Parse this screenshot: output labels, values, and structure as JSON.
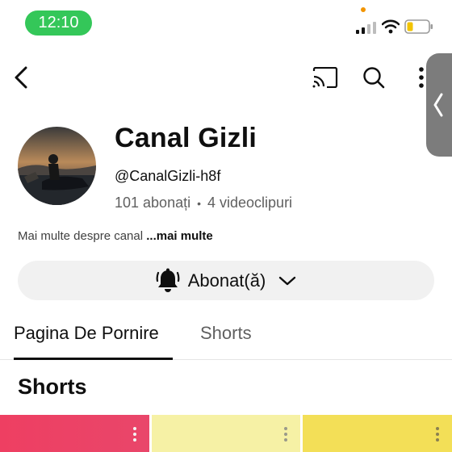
{
  "status_bar": {
    "time": "12:10"
  },
  "top_bar": {
    "back_icon": "chevron-left-icon",
    "cast_icon": "cast-icon",
    "search_icon": "search-icon",
    "more_icon": "more-vertical-icon"
  },
  "channel": {
    "name": "Canal Gizli",
    "handle": "@CanalGizli-h8f",
    "subscribers": "101 abonați",
    "separator": "•",
    "videos": "4 videoclipuri",
    "about_text": "Mai multe despre canal ",
    "about_more": "...mai multe"
  },
  "subscribe": {
    "label": "Abonat(ă)",
    "bell_icon": "bell-icon",
    "dropdown_icon": "chevron-down-icon"
  },
  "tabs": [
    {
      "label": "Pagina De Pornire",
      "active": true
    },
    {
      "label": "Shorts",
      "active": false
    }
  ],
  "section": {
    "title": "Shorts"
  },
  "colors": {
    "status_green": "#34c759",
    "short_1": "#ee3f62",
    "short_2": "#f6f1a5",
    "short_3": "#f3df57"
  }
}
